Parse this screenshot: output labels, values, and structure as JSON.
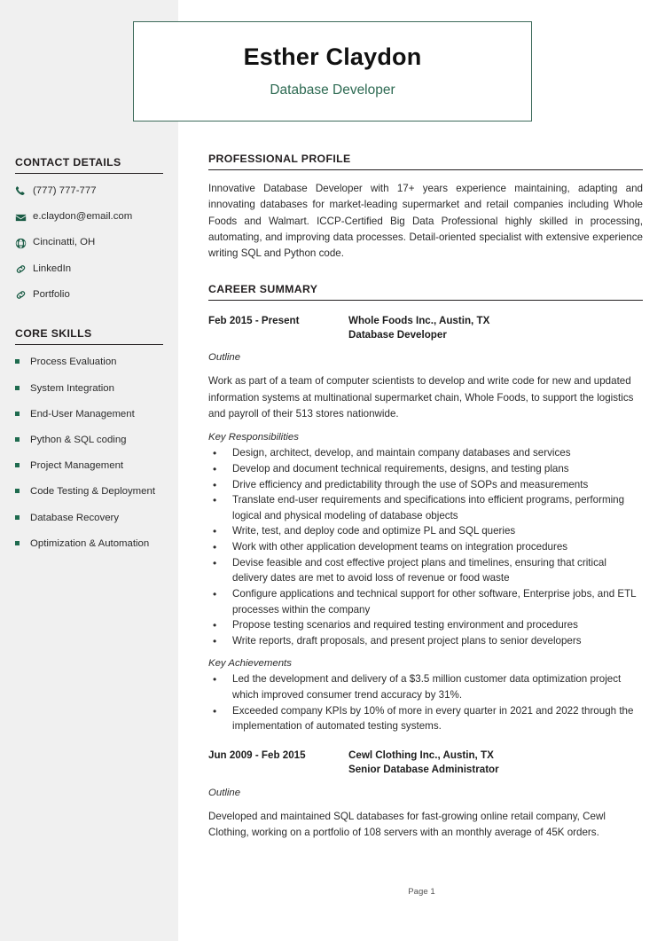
{
  "header": {
    "name": "Esther Claydon",
    "role": "Database Developer"
  },
  "sidebar": {
    "contact": {
      "heading": "CONTACT DETAILS",
      "items": [
        {
          "icon": "phone-icon",
          "text": "(777) 777-777"
        },
        {
          "icon": "envelope-icon",
          "text": "e.claydon@email.com"
        },
        {
          "icon": "globe-icon",
          "text": "Cincinatti, OH"
        },
        {
          "icon": "link-icon",
          "text": "LinkedIn"
        },
        {
          "icon": "link-icon",
          "text": "Portfolio"
        }
      ]
    },
    "skills": {
      "heading": "CORE SKILLS",
      "items": [
        "Process Evaluation",
        "System Integration",
        "End-User Management",
        "Python & SQL coding",
        "Project Management",
        "Code Testing & Deployment",
        "Database Recovery",
        "Optimization & Automation"
      ]
    }
  },
  "main": {
    "profile": {
      "heading": "PROFESSIONAL PROFILE",
      "text": "Innovative Database Developer with 17+ years experience maintaining, adapting and innovating databases for market-leading supermarket and retail companies including Whole Foods and Walmart. ICCP-Certified Big Data Professional highly skilled in processing, automating, and improving data processes. Detail-oriented specialist with extensive experience writing SQL and Python code."
    },
    "career": {
      "heading": "CAREER SUMMARY",
      "jobs": [
        {
          "dates": "Feb 2015 - Present",
          "company": "Whole Foods Inc., Austin, TX",
          "title": "Database Developer",
          "outline_label": "Outline",
          "outline": "Work as part of a team of computer scientists to develop and write code for new and updated information systems at multinational supermarket chain, Whole Foods, to support the logistics and payroll of their 513 stores nationwide.",
          "responsibilities_label": "Key Responsibilities",
          "responsibilities": [
            "Design, architect, develop, and maintain company databases and services",
            "Develop and document technical requirements, designs, and testing plans",
            "Drive efficiency and predictability through the use of SOPs and measurements",
            "Translate end-user requirements and specifications into efficient programs, performing logical and physical modeling of database objects",
            "Write, test, and deploy code and optimize PL and SQL queries",
            "Work with other application development teams on integration procedures",
            "Devise feasible and cost effective project plans and timelines, ensuring that critical delivery dates are met to avoid loss of revenue or food waste",
            "Configure applications and technical support for other software, Enterprise jobs, and ETL processes within the company",
            "Propose testing scenarios and required testing environment and procedures",
            "Write reports, draft proposals, and present project plans to senior developers"
          ],
          "achievements_label": "Key Achievements",
          "achievements": [
            "Led the development and delivery of a $3.5 million customer data optimization project which improved consumer trend accuracy by 31%.",
            "Exceeded company KPIs by 10% of more in every quarter in 2021 and 2022 through the implementation of automated testing systems."
          ]
        },
        {
          "dates": "Jun 2009 - Feb 2015",
          "company": "Cewl Clothing Inc., Austin, TX",
          "title": "Senior Database Administrator",
          "outline_label": "Outline",
          "outline": "Developed and maintained SQL databases for fast-growing online retail company, Cewl Clothing, working on a portfolio of 108 servers with an monthly average of 45K orders."
        }
      ]
    }
  },
  "footer": {
    "page_label": "Page 1"
  }
}
